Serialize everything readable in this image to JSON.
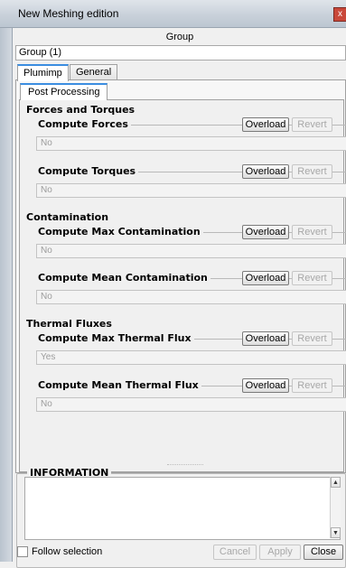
{
  "window": {
    "title": "New Meshing edition",
    "close_label": "x"
  },
  "header": {
    "label": "Group"
  },
  "group": {
    "value": "Group (1)"
  },
  "tabs": [
    {
      "label": "Plumimp"
    },
    {
      "label": "General"
    }
  ],
  "inner_tab": {
    "label": "Post Processing"
  },
  "overload_label": "Overload",
  "revert_label": "Revert",
  "sections": [
    {
      "title": "Forces and Torques",
      "params": [
        {
          "label": "Compute Forces",
          "value": "No"
        },
        {
          "label": "Compute Torques",
          "value": "No"
        }
      ]
    },
    {
      "title": "Contamination",
      "params": [
        {
          "label": "Compute Max Contamination",
          "value": "No"
        },
        {
          "label": "Compute Mean Contamination",
          "value": "No"
        }
      ]
    },
    {
      "title": "Thermal Fluxes",
      "params": [
        {
          "label": "Compute Max Thermal Flux",
          "value": "Yes"
        },
        {
          "label": "Compute Mean Thermal Flux",
          "value": "No"
        }
      ]
    }
  ],
  "information": {
    "title": "INFORMATION",
    "text": ""
  },
  "footer": {
    "follow_selection": "Follow selection",
    "follow_checked": false,
    "cancel": "Cancel",
    "apply": "Apply",
    "close": "Close"
  },
  "colors": {
    "tab_accent": "#3b8de0",
    "close_button": "#c9483a"
  }
}
